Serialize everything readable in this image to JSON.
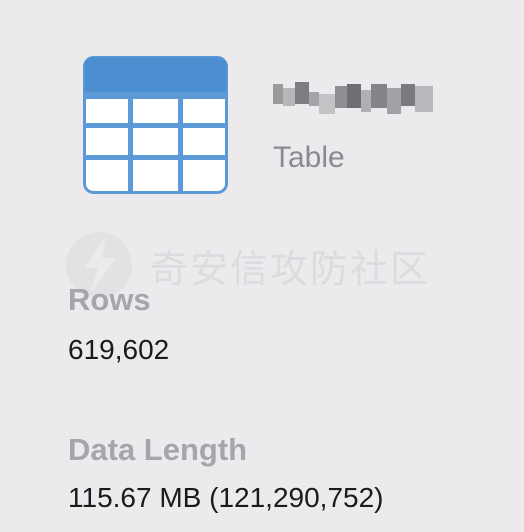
{
  "object": {
    "icon": "table-icon",
    "type_label": "Table"
  },
  "watermark": {
    "icon": "lightning-logo-icon",
    "text": "奇安信攻防社区"
  },
  "properties": {
    "rows_label": "Rows",
    "rows_value": "619,602",
    "data_length_label": "Data Length",
    "data_length_value": "115.67 MB (121,290,752)"
  },
  "colors": {
    "background": "#eceaed",
    "icon_header": "#4b8fd0",
    "icon_border": "#5b9ad6",
    "label_gray": "#a6a5a9",
    "value_text": "#1b1b1d"
  }
}
